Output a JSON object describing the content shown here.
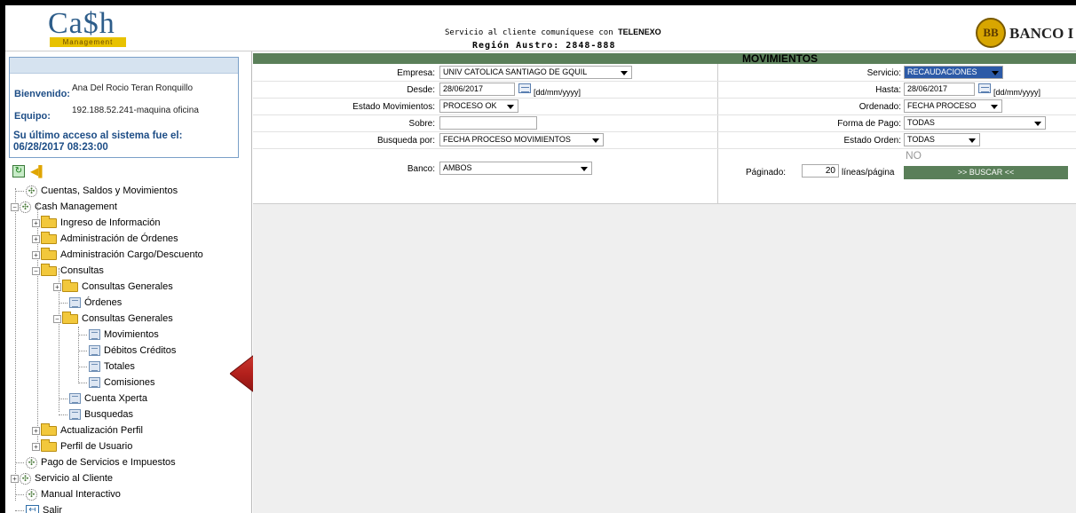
{
  "header": {
    "logo_text": "Ca$h",
    "logo_sub": "Management",
    "support_prefix": "Servicio al cliente comuníquese con",
    "support_brand": "TELENEXO",
    "support_region": "Región Austro: 2848-888",
    "bank_seal": "BB",
    "bank_name": "BANCO I"
  },
  "user": {
    "welcome_label": "Bienvenido:",
    "welcome_value": "Ana Del Rocio Teran Ronquillo",
    "team_label": "Equipo:",
    "team_value": "192.188.52.241-maquina oficina",
    "last_access": "Su último acceso al sistema fue el: 06/28/2017 08:23:00"
  },
  "tree": [
    {
      "label": "Cuentas, Saldos y Movimientos",
      "type": "node"
    },
    {
      "label": "Cash Management",
      "type": "node"
    },
    {
      "label": "Ingreso de Información",
      "type": "folder"
    },
    {
      "label": "Administración de Órdenes",
      "type": "folder"
    },
    {
      "label": "Administración Cargo/Descuento",
      "type": "folder"
    },
    {
      "label": "Consultas",
      "type": "folder"
    },
    {
      "label": "Consultas Generales",
      "type": "folder"
    },
    {
      "label": "Órdenes",
      "type": "doc"
    },
    {
      "label": "Consultas Generales",
      "type": "folder"
    },
    {
      "label": "Movimientos",
      "type": "doc"
    },
    {
      "label": "Débitos Créditos",
      "type": "doc"
    },
    {
      "label": "Totales",
      "type": "doc"
    },
    {
      "label": "Comisiones",
      "type": "doc"
    },
    {
      "label": "Cuenta Xperta",
      "type": "doc"
    },
    {
      "label": "Busquedas",
      "type": "doc"
    },
    {
      "label": "Actualización Perfil",
      "type": "folder"
    },
    {
      "label": "Perfil de Usuario",
      "type": "folder"
    },
    {
      "label": "Pago de Servicios e Impuestos",
      "type": "node"
    },
    {
      "label": "Servicio al Cliente",
      "type": "node"
    },
    {
      "label": "Manual Interactivo",
      "type": "node"
    },
    {
      "label": "Salir",
      "type": "exit"
    }
  ],
  "main": {
    "title": "MOVIMIENTOS",
    "left": {
      "empresa_label": "Empresa:",
      "empresa_value": "UNIV CATOLICA SANTIAGO DE GQUIL",
      "desde_label": "Desde:",
      "desde_value": "28/06/2017",
      "date_format": "[dd/mm/yyyy]",
      "estado_label": "Estado Movimientos:",
      "estado_value": "PROCESO OK",
      "sobre_label": "Sobre:",
      "sobre_value": "",
      "busqueda_label": "Busqueda por:",
      "busqueda_value": "FECHA PROCESO MOVIMIENTOS",
      "banco_label": "Banco:",
      "banco_value": "AMBOS"
    },
    "right": {
      "servicio_label": "Servicio:",
      "servicio_value": "RECAUDACIONES",
      "hasta_label": "Hasta:",
      "hasta_value": "28/06/2017",
      "date_format": "[dd/mm/yyyy]",
      "ordenado_label": "Ordenado:",
      "ordenado_value": "FECHA PROCESO",
      "forma_label": "Forma de Pago:",
      "forma_value": "TODAS",
      "estado_orden_label": "Estado Orden:",
      "estado_orden_value": "TODAS",
      "paginado_label": "Páginado:",
      "paginado_value": "20",
      "paginado_suffix": "líneas/página",
      "no_text": "NO",
      "buscar_label": ">> BUSCAR <<"
    }
  },
  "colors": {
    "title_bar": "#5a7f59",
    "link_blue": "#1d4d86",
    "arrow_red": "#b3201c"
  }
}
